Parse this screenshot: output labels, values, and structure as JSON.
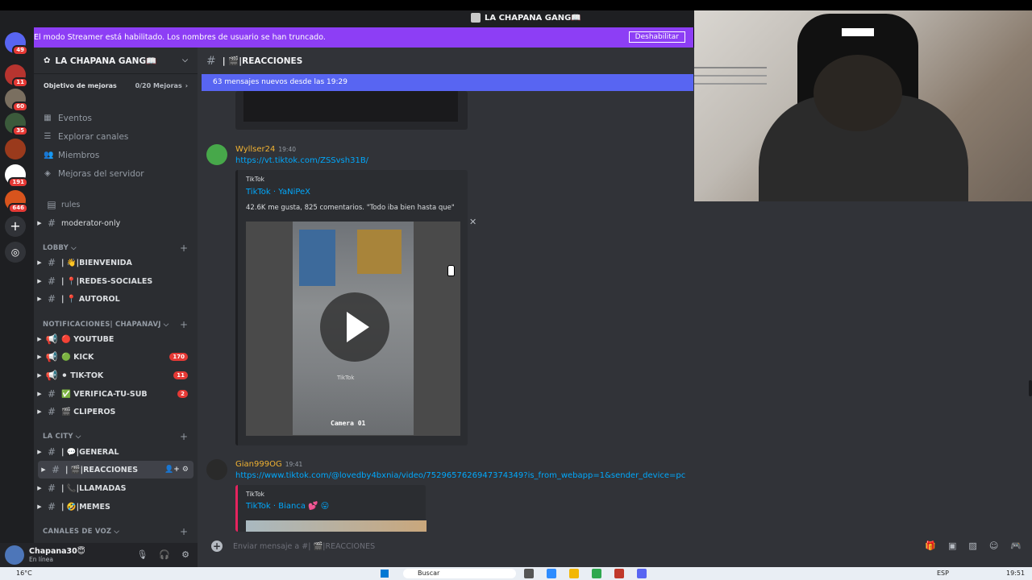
{
  "window": {
    "title": "LA CHAPANA GANG📖"
  },
  "servers": [
    {
      "badge": "49"
    },
    {
      "badge": "11"
    },
    {
      "badge": "60"
    },
    {
      "badge": "35"
    },
    {
      "badge": ""
    },
    {
      "badge": "191"
    },
    {
      "badge": "646"
    }
  ],
  "streamer": {
    "message": "El modo Streamer está habilitado. Los nombres de usuario se han truncado.",
    "button": "Deshabilitar"
  },
  "guild": {
    "name": "LA CHAPANA GANG📖",
    "boost_label": "Objetivo de mejoras",
    "boost_value": "0/20 Mejoras"
  },
  "nav": [
    "Eventos",
    "Explorar canales",
    "Miembros",
    "Mejoras del servidor"
  ],
  "plain_channels": [
    "rules",
    "moderator-only"
  ],
  "categories": {
    "lobby": "LOBBY",
    "notif": "NOTIFICACIONES| CHAPANAVJ",
    "city": "LA CITY",
    "voice": "CANALES DE VOZ"
  },
  "channels": {
    "lobby": [
      {
        "name": "| 👋|BIENVENIDA"
      },
      {
        "name": "| 📍|REDES-SOCIALES"
      },
      {
        "name": "| 📍 AUTOROL"
      }
    ],
    "notif": [
      {
        "name": "🔴 YOUTUBE",
        "badge": ""
      },
      {
        "name": "🟢 KICK",
        "badge": "170"
      },
      {
        "name": "⚫ TIK-TOK",
        "badge": "11"
      },
      {
        "name": "✅ VERIFICA-TU-SUB",
        "badge": "2"
      },
      {
        "name": "🎬 CLIPEROS",
        "badge": ""
      }
    ],
    "city": [
      {
        "name": "| 💬|GENERAL"
      },
      {
        "name": "| 🎬|REACCIONES"
      },
      {
        "name": "| 📞|LLAMADAS"
      },
      {
        "name": "| 🤣|MEMES"
      }
    ]
  },
  "user": {
    "name": "Chapana30😇",
    "status": "En línea"
  },
  "channel": {
    "name": "| 🎬|REACCIONES",
    "new_messages": "63 mensajes nuevos desde las 19:29"
  },
  "messages": [
    {
      "author": "Wyllser24",
      "time": "19:40",
      "link": "https://vt.tiktok.com/ZSSvsh31B/",
      "embed": {
        "provider": "TikTok",
        "title": "TikTok · YaNiPeX",
        "desc": "42.6K me gusta, 825 comentarios. \"Todo iba bien hasta que\"",
        "caption": "Camera 01",
        "watermark": "TikTok"
      }
    },
    {
      "author": "Gian999OG",
      "time": "19:41",
      "link": "https://www.tiktok.com/@lovedby4bxnia/video/7529657626947374349?is_from_webapp=1&sender_device=pc",
      "embed": {
        "provider": "TikTok",
        "title": "TikTok · Bianca 💕 😛"
      }
    }
  ],
  "composer": {
    "placeholder": "Enviar mensaje a #| 🎬|REACCIONES"
  },
  "taskbar": {
    "weather": "16°C",
    "search": "Buscar",
    "lang": "ESP",
    "time": "19:51"
  },
  "colors": {
    "accent": "#5865f2",
    "streamer": "#8d3ef5",
    "link": "#00a8fc",
    "username": "#f0b232"
  }
}
